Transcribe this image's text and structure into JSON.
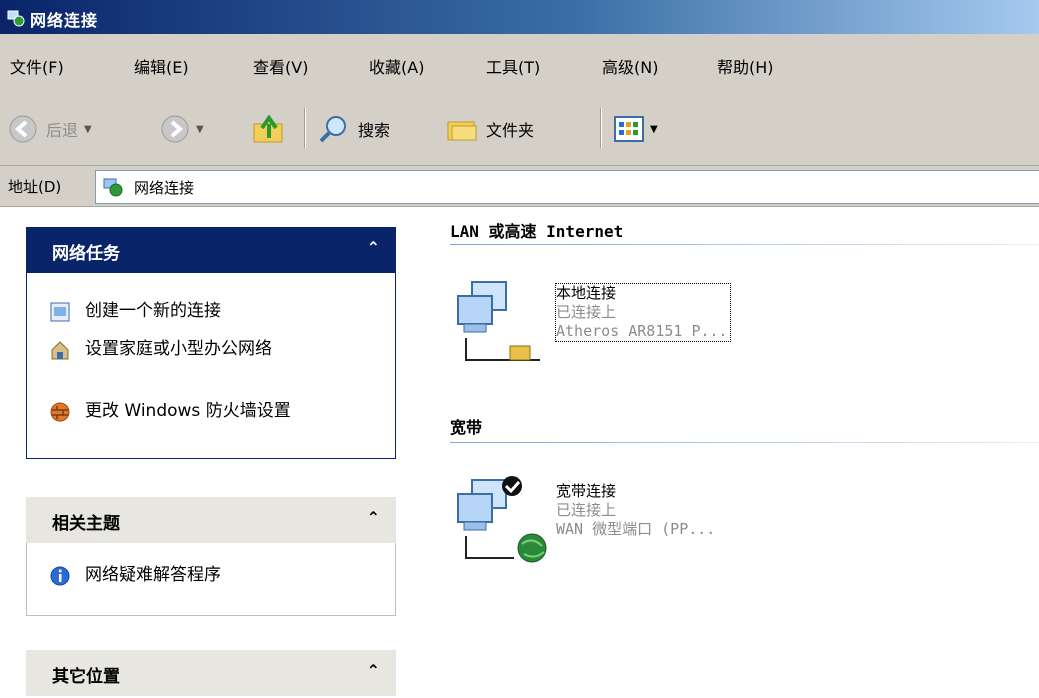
{
  "window": {
    "title": "网络连接"
  },
  "menu": [
    "文件(F)",
    "编辑(E)",
    "查看(V)",
    "收藏(A)",
    "工具(T)",
    "高级(N)",
    "帮助(H)"
  ],
  "toolbar": {
    "back_label": "后退",
    "search_label": "搜索",
    "folders_label": "文件夹"
  },
  "address": {
    "label": "地址(D)",
    "value": "网络连接"
  },
  "left_pane": {
    "network_tasks": {
      "title": "网络任务",
      "items": [
        "创建一个新的连接",
        "设置家庭或小型办公网络",
        "更改 Windows 防火墙设置"
      ]
    },
    "related_topics": {
      "title": "相关主题",
      "items": [
        "网络疑难解答程序"
      ]
    },
    "other_places": {
      "title": "其它位置"
    }
  },
  "content": {
    "groups": [
      {
        "header": "LAN 或高速 Internet",
        "connection": {
          "name": "本地连接",
          "status": "已连接上",
          "device": "Atheros AR8151 P..."
        }
      },
      {
        "header": "宽带",
        "connection": {
          "name": "宽带连接",
          "status": "已连接上",
          "device": "WAN 微型端口 (PP..."
        }
      }
    ]
  },
  "colors": {
    "titlebar": "#0a246a",
    "chrome": "#d4d0c8",
    "task_header": "#0a246a",
    "status_text": "#8c8c8c"
  }
}
